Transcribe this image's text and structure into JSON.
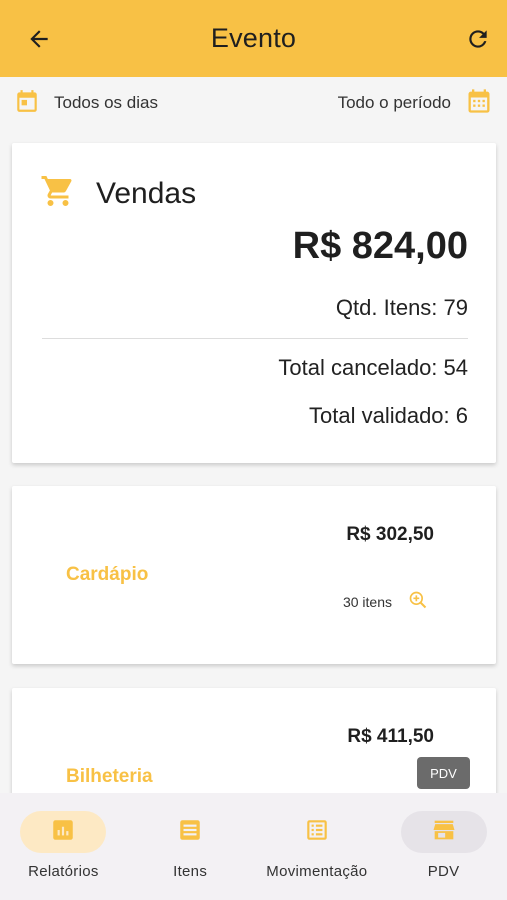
{
  "appbar": {
    "title": "Evento",
    "back_icon": "arrow-left-icon",
    "refresh_icon": "refresh-icon"
  },
  "filters": {
    "days_label": "Todos os dias",
    "period_label": "Todo o período"
  },
  "sales": {
    "label": "Vendas",
    "total": "R$ 824,00",
    "qtd": "Qtd. Itens: 79",
    "cancelado": "Total cancelado: 54",
    "validado": "Total validado: 6"
  },
  "items": [
    {
      "name": "Cardápio",
      "price": "R$ 302,50",
      "count": "30 itens"
    },
    {
      "name": "Bilheteria",
      "price": "R$ 411,50"
    }
  ],
  "tooltip": "PDV",
  "nav": [
    {
      "label": "Relatórios",
      "icon": "report-chart-icon",
      "active": true
    },
    {
      "label": "Itens",
      "icon": "list-icon"
    },
    {
      "label": "Movimentação",
      "icon": "list-alt-icon"
    },
    {
      "label": "PDV",
      "icon": "store-icon"
    }
  ],
  "colors": {
    "accent": "#f8c145",
    "active_pill": "#fde9c4"
  }
}
